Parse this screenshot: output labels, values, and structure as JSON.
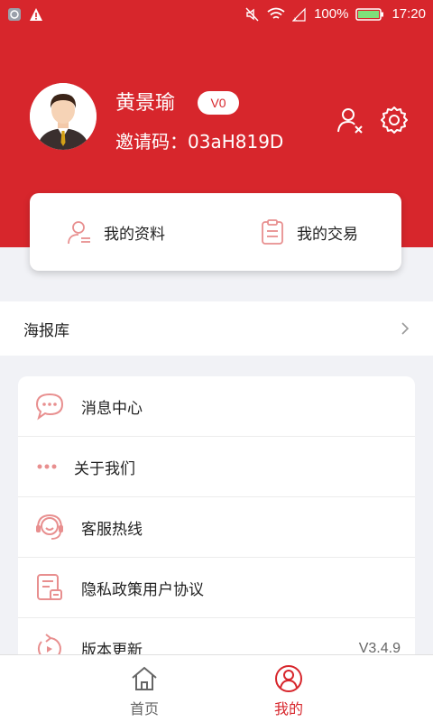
{
  "status_bar": {
    "battery": "100%",
    "time": "17:20"
  },
  "profile": {
    "name": "黄景瑜",
    "level": "V0",
    "invite_code": "邀请码：03aH819D"
  },
  "quick_card": {
    "my_profile": "我的资料",
    "my_trades": "我的交易"
  },
  "poster": {
    "label": "海报库"
  },
  "menu": {
    "items": [
      {
        "label": "消息中心",
        "icon": "chat-bubble-icon"
      },
      {
        "label": "关于我们",
        "icon": "more-dots-icon"
      },
      {
        "label": "客服热线",
        "icon": "headset-icon"
      },
      {
        "label": "隐私政策用户协议",
        "icon": "document-icon"
      },
      {
        "label": "版本更新",
        "icon": "refresh-icon",
        "value": "V3.4.9"
      }
    ]
  },
  "tabbar": {
    "home": "首页",
    "mine": "我的"
  },
  "colors": {
    "brand_red": "#d7262c",
    "icon_pink": "#e88f8f",
    "background": "#f1f2f6"
  }
}
